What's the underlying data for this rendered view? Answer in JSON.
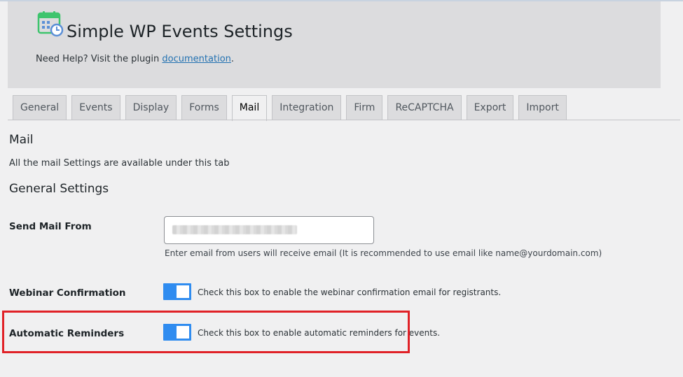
{
  "header": {
    "title": "Simple WP Events Settings",
    "help_prefix": "Need Help? Visit the plugin ",
    "help_link": "documentation",
    "help_suffix": ".",
    "logo_icon": "calendar-clock-icon",
    "accent_color": "#3ec46d"
  },
  "tabs": [
    {
      "label": "General"
    },
    {
      "label": "Events"
    },
    {
      "label": "Display"
    },
    {
      "label": "Forms"
    },
    {
      "label": "Mail",
      "active": true
    },
    {
      "label": "Integration"
    },
    {
      "label": "Firm"
    },
    {
      "label": "ReCAPTCHA"
    },
    {
      "label": "Export"
    },
    {
      "label": "Import"
    }
  ],
  "mail": {
    "title": "Mail",
    "description": "All the mail Settings are available under this tab",
    "general_title": "General Settings",
    "send_mail_from": {
      "label": "Send Mail From",
      "value": "",
      "description": "Enter email from users will receive email (It is recommended to use email like name@yourdomain.com)"
    },
    "webinar_confirmation": {
      "label": "Webinar Confirmation",
      "enabled": true,
      "description": "Check this box to enable the webinar confirmation email for registrants."
    },
    "automatic_reminders": {
      "label": "Automatic Reminders",
      "enabled": true,
      "description": "Check this box to enable automatic reminders for events."
    }
  },
  "colors": {
    "toggle_on": "#2f8cf0",
    "highlight_border": "#e02127",
    "link": "#2271b1"
  }
}
